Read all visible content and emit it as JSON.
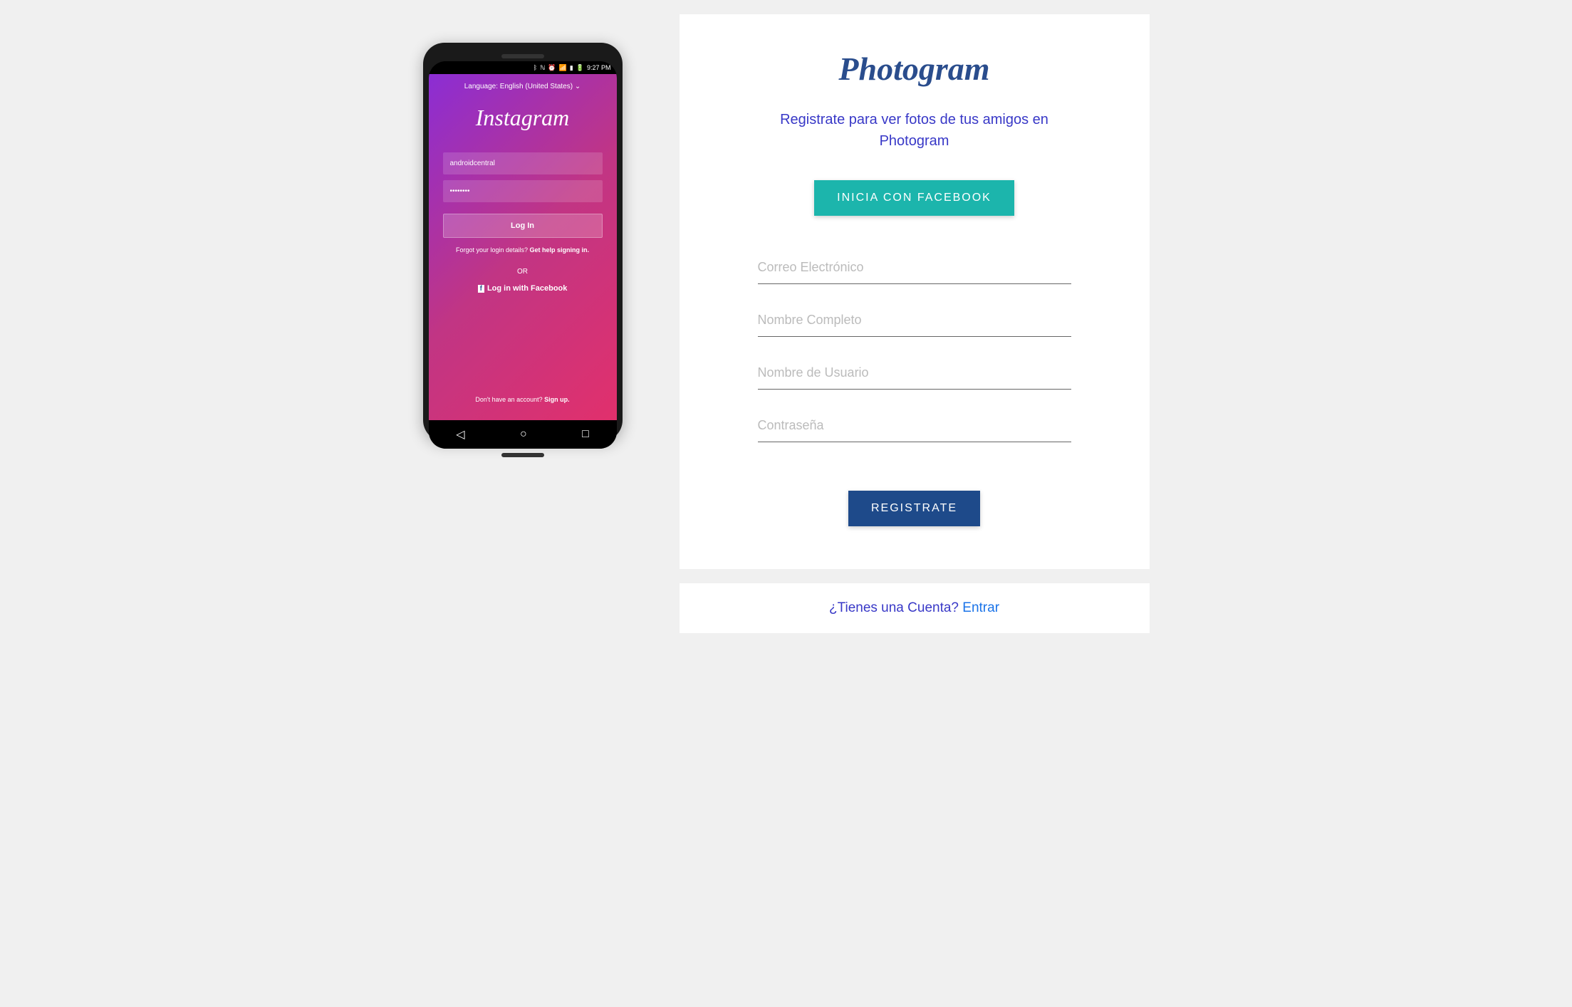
{
  "brand": {
    "title": "Photogram"
  },
  "subtitle": "Registrate para ver fotos de tus amigos en Photogram",
  "buttons": {
    "facebook": "INICIA CON FACEBOOK",
    "register": "REGISTRATE"
  },
  "inputs": {
    "email_placeholder": "Correo Electrónico",
    "fullname_placeholder": "Nombre Completo",
    "username_placeholder": "Nombre de Usuario",
    "password_placeholder": "Contraseña"
  },
  "login_prompt": {
    "text": "¿Tienes una Cuenta? ",
    "link": "Entrar"
  },
  "phone": {
    "status_time": "9:27 PM",
    "language": "Language: English (United States) ⌄",
    "logo": "Instagram",
    "username_value": "androidcentral",
    "password_value": "••••••••",
    "login_label": "Log In",
    "forgot_text": "Forgot your login details? ",
    "forgot_link": "Get help signing in.",
    "or_text": "OR",
    "fb_login": "Log in with Facebook",
    "signup_text": "Don't have an account? ",
    "signup_link": "Sign up."
  }
}
